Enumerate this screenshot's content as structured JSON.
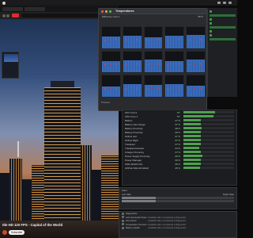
{
  "menubar": {
    "app_name": "",
    "clock": ""
  },
  "video": {
    "caption": "ttle HD 120 FPS - Capital of the World",
    "subscribe_label": "Subscribe"
  },
  "temps_panel": {
    "title": "Temperatures",
    "core_label": "Efficiency Core 1",
    "core_value": "35°C",
    "footer": "Process"
  },
  "sensors": [
    {
      "name": "GPU Cores",
      "value": "70°",
      "level": 0.62
    },
    {
      "name": "CPU Core 1",
      "value": "70°",
      "level": 0.6
    },
    {
      "name": "Battery",
      "value": "37°C",
      "level": 0.35
    },
    {
      "name": "Battery Gas Gauge",
      "value": "37°C",
      "level": 0.35
    },
    {
      "name": "Battery Proximity",
      "value": "38°C",
      "level": 0.36
    },
    {
      "name": "Battery Proximity",
      "value": "36°C",
      "level": 0.34
    },
    {
      "name": "Airflow Left",
      "value": "37°C",
      "level": 0.35
    },
    {
      "name": "Airflow Right",
      "value": "37°C",
      "level": 0.35
    },
    {
      "name": "Trackpad",
      "value": "37°C",
      "level": 0.35
    },
    {
      "name": "Trackpad Actuator",
      "value": "34°C",
      "level": 0.32
    },
    {
      "name": "Charger Proximity",
      "value": "37°C",
      "level": 0.35
    },
    {
      "name": "Power Supply Proximity",
      "value": "40°C",
      "level": 0.38
    },
    {
      "name": "Power Manager",
      "value": "36°C",
      "level": 0.34
    },
    {
      "name": "SSD (NAND I/O)",
      "value": "36°C",
      "level": 0.34
    },
    {
      "name": "APPLE SSD AP1024Z",
      "value": "35°C",
      "level": 0.33
    }
  ],
  "fans": {
    "title": "Fans",
    "left_label": "Left Side",
    "right_label": "Right Side",
    "left_level": 0.3,
    "right_level": 0.3
  },
  "diagnostics": {
    "title": "Diagnostics",
    "rows": [
      {
        "name": "Last Successful Scan",
        "status": "Available after completing a Diagnostic"
      },
      {
        "name": "Fan Issues",
        "status": "Available after completing a Diagnostic"
      },
      {
        "name": "Temperature Sensors",
        "status": "Available after completing a Diagnostic"
      },
      {
        "name": "Battery Health",
        "status": "Available after completing a Diagnostic"
      }
    ]
  },
  "graph_levels": [
    0.55,
    0.6,
    0.5,
    0.58,
    0.62,
    0.52,
    0.57,
    0.6,
    0.55,
    0.63,
    0.5,
    0.59,
    0.56,
    0.61,
    0.54
  ],
  "colors": {
    "accent_green": "#4fa04f",
    "graph_blue": "#3e74c8",
    "spike_red": "#e63c3c"
  }
}
